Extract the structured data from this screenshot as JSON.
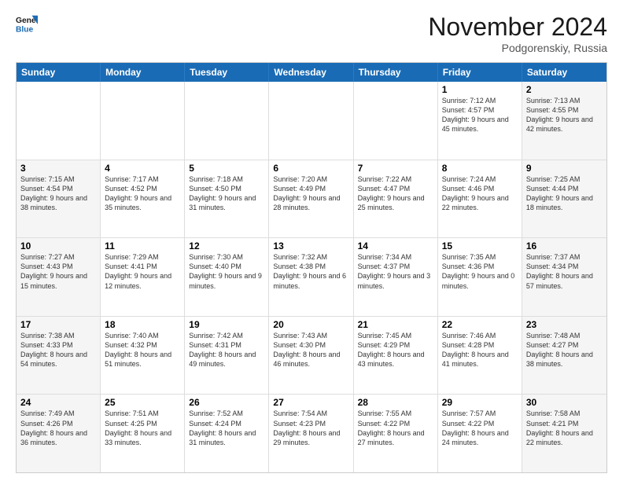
{
  "header": {
    "logo_line1": "General",
    "logo_line2": "Blue",
    "title": "November 2024",
    "location": "Podgorenskiy, Russia"
  },
  "days_of_week": [
    "Sunday",
    "Monday",
    "Tuesday",
    "Wednesday",
    "Thursday",
    "Friday",
    "Saturday"
  ],
  "weeks": [
    [
      {
        "day": "",
        "sunrise": "",
        "sunset": "",
        "daylight": "",
        "weekend": false,
        "empty": true
      },
      {
        "day": "",
        "sunrise": "",
        "sunset": "",
        "daylight": "",
        "weekend": false,
        "empty": true
      },
      {
        "day": "",
        "sunrise": "",
        "sunset": "",
        "daylight": "",
        "weekend": false,
        "empty": true
      },
      {
        "day": "",
        "sunrise": "",
        "sunset": "",
        "daylight": "",
        "weekend": false,
        "empty": true
      },
      {
        "day": "",
        "sunrise": "",
        "sunset": "",
        "daylight": "",
        "weekend": false,
        "empty": true
      },
      {
        "day": "1",
        "sunrise": "Sunrise: 7:12 AM",
        "sunset": "Sunset: 4:57 PM",
        "daylight": "Daylight: 9 hours and 45 minutes.",
        "weekend": false,
        "empty": false
      },
      {
        "day": "2",
        "sunrise": "Sunrise: 7:13 AM",
        "sunset": "Sunset: 4:55 PM",
        "daylight": "Daylight: 9 hours and 42 minutes.",
        "weekend": true,
        "empty": false
      }
    ],
    [
      {
        "day": "3",
        "sunrise": "Sunrise: 7:15 AM",
        "sunset": "Sunset: 4:54 PM",
        "daylight": "Daylight: 9 hours and 38 minutes.",
        "weekend": true,
        "empty": false
      },
      {
        "day": "4",
        "sunrise": "Sunrise: 7:17 AM",
        "sunset": "Sunset: 4:52 PM",
        "daylight": "Daylight: 9 hours and 35 minutes.",
        "weekend": false,
        "empty": false
      },
      {
        "day": "5",
        "sunrise": "Sunrise: 7:18 AM",
        "sunset": "Sunset: 4:50 PM",
        "daylight": "Daylight: 9 hours and 31 minutes.",
        "weekend": false,
        "empty": false
      },
      {
        "day": "6",
        "sunrise": "Sunrise: 7:20 AM",
        "sunset": "Sunset: 4:49 PM",
        "daylight": "Daylight: 9 hours and 28 minutes.",
        "weekend": false,
        "empty": false
      },
      {
        "day": "7",
        "sunrise": "Sunrise: 7:22 AM",
        "sunset": "Sunset: 4:47 PM",
        "daylight": "Daylight: 9 hours and 25 minutes.",
        "weekend": false,
        "empty": false
      },
      {
        "day": "8",
        "sunrise": "Sunrise: 7:24 AM",
        "sunset": "Sunset: 4:46 PM",
        "daylight": "Daylight: 9 hours and 22 minutes.",
        "weekend": false,
        "empty": false
      },
      {
        "day": "9",
        "sunrise": "Sunrise: 7:25 AM",
        "sunset": "Sunset: 4:44 PM",
        "daylight": "Daylight: 9 hours and 18 minutes.",
        "weekend": true,
        "empty": false
      }
    ],
    [
      {
        "day": "10",
        "sunrise": "Sunrise: 7:27 AM",
        "sunset": "Sunset: 4:43 PM",
        "daylight": "Daylight: 9 hours and 15 minutes.",
        "weekend": true,
        "empty": false
      },
      {
        "day": "11",
        "sunrise": "Sunrise: 7:29 AM",
        "sunset": "Sunset: 4:41 PM",
        "daylight": "Daylight: 9 hours and 12 minutes.",
        "weekend": false,
        "empty": false
      },
      {
        "day": "12",
        "sunrise": "Sunrise: 7:30 AM",
        "sunset": "Sunset: 4:40 PM",
        "daylight": "Daylight: 9 hours and 9 minutes.",
        "weekend": false,
        "empty": false
      },
      {
        "day": "13",
        "sunrise": "Sunrise: 7:32 AM",
        "sunset": "Sunset: 4:38 PM",
        "daylight": "Daylight: 9 hours and 6 minutes.",
        "weekend": false,
        "empty": false
      },
      {
        "day": "14",
        "sunrise": "Sunrise: 7:34 AM",
        "sunset": "Sunset: 4:37 PM",
        "daylight": "Daylight: 9 hours and 3 minutes.",
        "weekend": false,
        "empty": false
      },
      {
        "day": "15",
        "sunrise": "Sunrise: 7:35 AM",
        "sunset": "Sunset: 4:36 PM",
        "daylight": "Daylight: 9 hours and 0 minutes.",
        "weekend": false,
        "empty": false
      },
      {
        "day": "16",
        "sunrise": "Sunrise: 7:37 AM",
        "sunset": "Sunset: 4:34 PM",
        "daylight": "Daylight: 8 hours and 57 minutes.",
        "weekend": true,
        "empty": false
      }
    ],
    [
      {
        "day": "17",
        "sunrise": "Sunrise: 7:38 AM",
        "sunset": "Sunset: 4:33 PM",
        "daylight": "Daylight: 8 hours and 54 minutes.",
        "weekend": true,
        "empty": false
      },
      {
        "day": "18",
        "sunrise": "Sunrise: 7:40 AM",
        "sunset": "Sunset: 4:32 PM",
        "daylight": "Daylight: 8 hours and 51 minutes.",
        "weekend": false,
        "empty": false
      },
      {
        "day": "19",
        "sunrise": "Sunrise: 7:42 AM",
        "sunset": "Sunset: 4:31 PM",
        "daylight": "Daylight: 8 hours and 49 minutes.",
        "weekend": false,
        "empty": false
      },
      {
        "day": "20",
        "sunrise": "Sunrise: 7:43 AM",
        "sunset": "Sunset: 4:30 PM",
        "daylight": "Daylight: 8 hours and 46 minutes.",
        "weekend": false,
        "empty": false
      },
      {
        "day": "21",
        "sunrise": "Sunrise: 7:45 AM",
        "sunset": "Sunset: 4:29 PM",
        "daylight": "Daylight: 8 hours and 43 minutes.",
        "weekend": false,
        "empty": false
      },
      {
        "day": "22",
        "sunrise": "Sunrise: 7:46 AM",
        "sunset": "Sunset: 4:28 PM",
        "daylight": "Daylight: 8 hours and 41 minutes.",
        "weekend": false,
        "empty": false
      },
      {
        "day": "23",
        "sunrise": "Sunrise: 7:48 AM",
        "sunset": "Sunset: 4:27 PM",
        "daylight": "Daylight: 8 hours and 38 minutes.",
        "weekend": true,
        "empty": false
      }
    ],
    [
      {
        "day": "24",
        "sunrise": "Sunrise: 7:49 AM",
        "sunset": "Sunset: 4:26 PM",
        "daylight": "Daylight: 8 hours and 36 minutes.",
        "weekend": true,
        "empty": false
      },
      {
        "day": "25",
        "sunrise": "Sunrise: 7:51 AM",
        "sunset": "Sunset: 4:25 PM",
        "daylight": "Daylight: 8 hours and 33 minutes.",
        "weekend": false,
        "empty": false
      },
      {
        "day": "26",
        "sunrise": "Sunrise: 7:52 AM",
        "sunset": "Sunset: 4:24 PM",
        "daylight": "Daylight: 8 hours and 31 minutes.",
        "weekend": false,
        "empty": false
      },
      {
        "day": "27",
        "sunrise": "Sunrise: 7:54 AM",
        "sunset": "Sunset: 4:23 PM",
        "daylight": "Daylight: 8 hours and 29 minutes.",
        "weekend": false,
        "empty": false
      },
      {
        "day": "28",
        "sunrise": "Sunrise: 7:55 AM",
        "sunset": "Sunset: 4:22 PM",
        "daylight": "Daylight: 8 hours and 27 minutes.",
        "weekend": false,
        "empty": false
      },
      {
        "day": "29",
        "sunrise": "Sunrise: 7:57 AM",
        "sunset": "Sunset: 4:22 PM",
        "daylight": "Daylight: 8 hours and 24 minutes.",
        "weekend": false,
        "empty": false
      },
      {
        "day": "30",
        "sunrise": "Sunrise: 7:58 AM",
        "sunset": "Sunset: 4:21 PM",
        "daylight": "Daylight: 8 hours and 22 minutes.",
        "weekend": true,
        "empty": false
      }
    ]
  ]
}
